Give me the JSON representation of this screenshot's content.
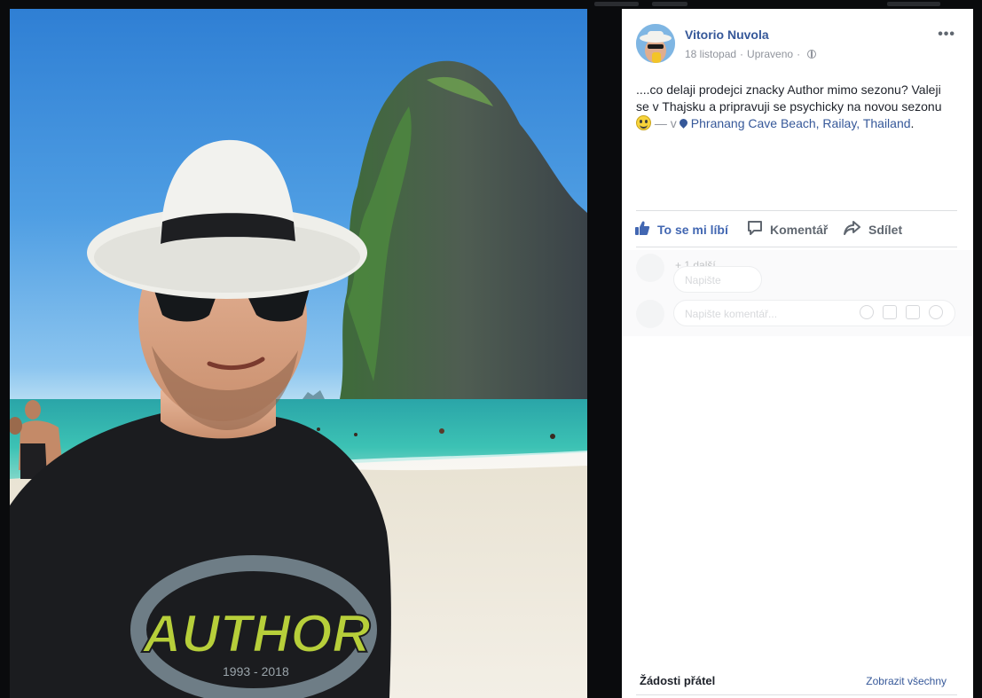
{
  "post": {
    "author_name": "Vitorio Nuvola",
    "date": "18 listopad",
    "separator": "·",
    "edited_label": "Upraveno",
    "more_label": "•••",
    "text_main": "....co delaji prodejci znacky Author mimo sezonu? Valeji se v Thajsku a pripravuji se psychicky na novou sezonu",
    "text_in": "— v",
    "location": "Phranang Cave Beach, Railay, Thailand",
    "text_end": "."
  },
  "actions": {
    "like": "To se mi líbí",
    "comment": "Komentář",
    "share": "Sdílet"
  },
  "comments": {
    "previous": "+ 1 další",
    "placeholder_small": "Napište komen",
    "placeholder": "Napište komentář..."
  },
  "sidebar": {
    "friend_requests": "Žádosti přátel",
    "see_all": "Zobrazit všechny"
  },
  "photo": {
    "shirt_text": "AUTHOR",
    "shirt_years": "1993 - 2018"
  },
  "colors": {
    "link": "#365899",
    "like_blue": "#4267b2",
    "text": "#1d2129",
    "muted": "#90949c",
    "backdrop": "#0a0b0d"
  },
  "icons": {
    "like": "thumbs-up-icon",
    "comment": "speech-bubble-icon",
    "share": "share-arrow-icon",
    "privacy": "globe-icon",
    "location": "map-pin-icon",
    "emoji": "smiley-icon"
  }
}
